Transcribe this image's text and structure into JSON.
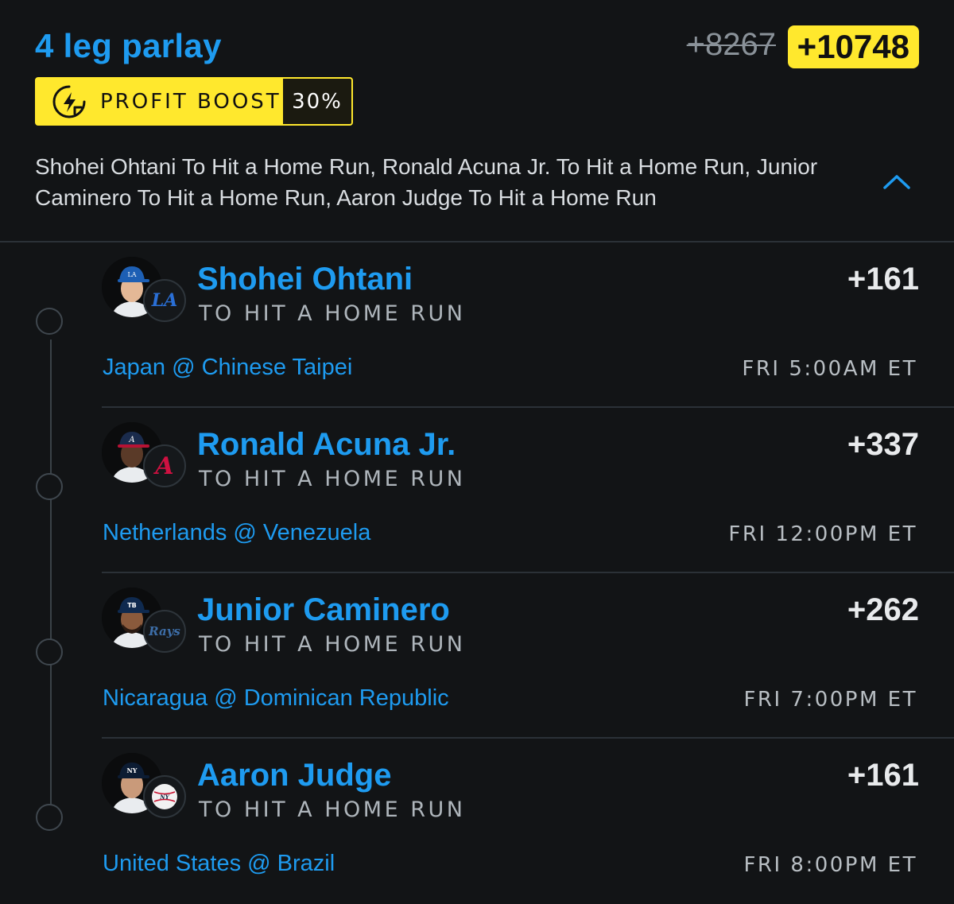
{
  "parlay": {
    "title": "4 leg parlay",
    "old_odds": "+8267",
    "boosted_odds": "+10748",
    "boost_label": "PROFIT BOOST",
    "boost_percent": "30%",
    "summary": "Shohei Ohtani To Hit a Home Run, Ronald Acuna Jr. To Hit a Home Run, Junior Caminero To Hit a Home Run, Aaron Judge To Hit a Home Run",
    "expanded": true
  },
  "colors": {
    "background": "#121416",
    "accent_blue": "#1e9bf0",
    "boost_yellow": "#ffe82d"
  },
  "legs": [
    {
      "player": "Shohei Ohtani",
      "market": "TO HIT A HOME RUN",
      "odds": "+161",
      "matchup": "Japan @ Chinese Taipei",
      "time": "FRI 5:00AM ET",
      "team_icon": "dodgers-logo-icon",
      "cap_color": "#1d5fb4"
    },
    {
      "player": "Ronald Acuna Jr.",
      "market": "TO HIT A HOME RUN",
      "odds": "+337",
      "matchup": "Netherlands @ Venezuela",
      "time": "FRI 12:00PM ET",
      "team_icon": "braves-logo-icon",
      "cap_color": "#1a2b4c"
    },
    {
      "player": "Junior Caminero",
      "market": "TO HIT A HOME RUN",
      "odds": "+262",
      "matchup": "Nicaragua @ Dominican Republic",
      "time": "FRI 7:00PM ET",
      "team_icon": "rays-logo-icon",
      "cap_color": "#0f2a4f"
    },
    {
      "player": "Aaron Judge",
      "market": "TO HIT A HOME RUN",
      "odds": "+161",
      "matchup": "United States @ Brazil",
      "time": "FRI 8:00PM ET",
      "team_icon": "yankees-logo-icon",
      "cap_color": "#0c1c33"
    }
  ]
}
